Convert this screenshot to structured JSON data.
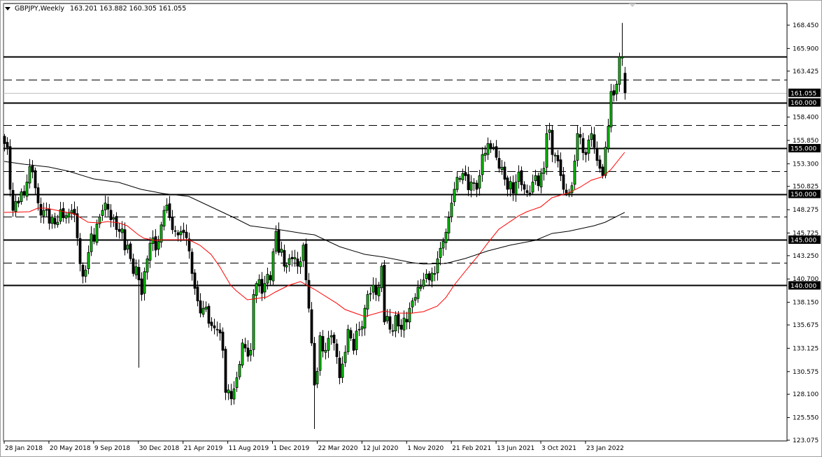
{
  "header": {
    "symbol": "GBPJPY,Weekly",
    "ohlc": "163.201 163.882 160.305 161.055"
  },
  "chart_data": {
    "type": "candlestick",
    "title": "GBPJPY,Weekly",
    "ylim": [
      123.075,
      168.45
    ],
    "y_ticks": [
      "168.450",
      "165.900",
      "163.425",
      "158.400",
      "155.850",
      "153.300",
      "150.825",
      "148.275",
      "145.725",
      "143.250",
      "140.700",
      "138.150",
      "135.675",
      "133.125",
      "130.575",
      "128.100",
      "125.550",
      "123.075"
    ],
    "y_tick_values": [
      168.45,
      165.9,
      163.425,
      158.4,
      155.85,
      153.3,
      150.825,
      148.275,
      145.725,
      143.25,
      140.7,
      138.15,
      135.675,
      133.125,
      130.575,
      128.1,
      125.55,
      123.075
    ],
    "x_ticks": [
      {
        "label": "28 Jan 2018",
        "week": 0
      },
      {
        "label": "20 May 2018",
        "week": 16
      },
      {
        "label": "9 Sep 2018",
        "week": 32
      },
      {
        "label": "30 Dec 2018",
        "week": 48
      },
      {
        "label": "21 Apr 2019",
        "week": 64
      },
      {
        "label": "11 Aug 2019",
        "week": 80
      },
      {
        "label": "1 Dec 2019",
        "week": 96
      },
      {
        "label": "22 Mar 2020",
        "week": 112
      },
      {
        "label": "12 Jul 2020",
        "week": 128
      },
      {
        "label": "1 Nov 2020",
        "week": 144
      },
      {
        "label": "21 Feb 2021",
        "week": 160
      },
      {
        "label": "13 Jun 2021",
        "week": 176
      },
      {
        "label": "3 Oct 2021",
        "week": 192
      },
      {
        "label": "23 Jan 2022",
        "week": 208
      }
    ],
    "current_price": {
      "value": 161.055,
      "label": "161.055"
    },
    "horizontal_levels": [
      {
        "value": 165.0,
        "style": "solid"
      },
      {
        "value": 162.5,
        "style": "dashed"
      },
      {
        "value": 160.0,
        "style": "solid",
        "label": "160.000"
      },
      {
        "value": 157.5,
        "style": "dashed"
      },
      {
        "value": 155.0,
        "style": "solid",
        "label": "155.000"
      },
      {
        "value": 152.5,
        "style": "dashed"
      },
      {
        "value": 150.0,
        "style": "solid",
        "label": "150.000"
      },
      {
        "value": 147.5,
        "style": "dashed"
      },
      {
        "value": 145.0,
        "style": "solid",
        "label": "145.000"
      },
      {
        "value": 142.5,
        "style": "dashed"
      },
      {
        "value": 140.0,
        "style": "solid",
        "label": "140.000"
      }
    ],
    "candle_count": 223,
    "close_path": [
      [
        0,
        155.5
      ],
      [
        1,
        155.1
      ],
      [
        2,
        150.5
      ],
      [
        3,
        148.2
      ],
      [
        5,
        149
      ],
      [
        8,
        151.3
      ],
      [
        10,
        152.4
      ],
      [
        12,
        149
      ],
      [
        14,
        148.2
      ],
      [
        18,
        146.7
      ],
      [
        21,
        147.4
      ],
      [
        24,
        148.2
      ],
      [
        26,
        145.2
      ],
      [
        28,
        141
      ],
      [
        30,
        143.6
      ],
      [
        33,
        146.7
      ],
      [
        35,
        148.2
      ],
      [
        36,
        149
      ],
      [
        39,
        147.4
      ],
      [
        41,
        145.9
      ],
      [
        44,
        144.4
      ],
      [
        46,
        141.3
      ],
      [
        48,
        140.6
      ],
      [
        49,
        139
      ],
      [
        51,
        142.9
      ],
      [
        53,
        145.2
      ],
      [
        55,
        144.8
      ],
      [
        57,
        148.2
      ],
      [
        59,
        147.4
      ],
      [
        61,
        145.9
      ],
      [
        63,
        145.9
      ],
      [
        65,
        145.2
      ],
      [
        67,
        141.3
      ],
      [
        69,
        138.3
      ],
      [
        71,
        137.5
      ],
      [
        74,
        135.6
      ],
      [
        76,
        135.2
      ],
      [
        78,
        132.9
      ],
      [
        79,
        128.3
      ],
      [
        81,
        127.6
      ],
      [
        83,
        129.9
      ],
      [
        85,
        133.7
      ],
      [
        88,
        132.9
      ],
      [
        89,
        139
      ],
      [
        90,
        140.2
      ],
      [
        93,
        140.2
      ],
      [
        95,
        140.6
      ],
      [
        97,
        145.9
      ],
      [
        98,
        143.6
      ],
      [
        100,
        142.1
      ],
      [
        103,
        142.9
      ],
      [
        105,
        142.1
      ],
      [
        107,
        144.4
      ],
      [
        108,
        140.6
      ],
      [
        109,
        137.5
      ],
      [
        110,
        133.7
      ],
      [
        111,
        129.1
      ],
      [
        112,
        130.6
      ],
      [
        113,
        134.5
      ],
      [
        115,
        132.9
      ],
      [
        117,
        134.5
      ],
      [
        119,
        132.2
      ],
      [
        120,
        129.9
      ],
      [
        121,
        131.4
      ],
      [
        123,
        135.2
      ],
      [
        125,
        132.9
      ],
      [
        127,
        135.2
      ],
      [
        129,
        137.5
      ],
      [
        130,
        139
      ],
      [
        133,
        139
      ],
      [
        134,
        139.8
      ],
      [
        135,
        142.1
      ],
      [
        136,
        136
      ],
      [
        138,
        135.2
      ],
      [
        140,
        136.7
      ],
      [
        142,
        135.2
      ],
      [
        144,
        136
      ],
      [
        145,
        137.5
      ],
      [
        146,
        138.3
      ],
      [
        148,
        139.8
      ],
      [
        150,
        140.6
      ],
      [
        152,
        140.6
      ],
      [
        154,
        141.3
      ],
      [
        155,
        142.9
      ],
      [
        157,
        144.8
      ],
      [
        159,
        147.4
      ],
      [
        160,
        149
      ],
      [
        161,
        150.5
      ],
      [
        163,
        151.6
      ],
      [
        165,
        152
      ],
      [
        167,
        151.3
      ],
      [
        169,
        150.5
      ],
      [
        170,
        152
      ],
      [
        171,
        154.3
      ],
      [
        173,
        155.5
      ],
      [
        175,
        155.1
      ],
      [
        177,
        152.8
      ],
      [
        179,
        151.6
      ],
      [
        180,
        150.5
      ],
      [
        183,
        151.3
      ],
      [
        184,
        152.4
      ],
      [
        186,
        150.5
      ],
      [
        188,
        150.1
      ],
      [
        189,
        151.3
      ],
      [
        190,
        152
      ],
      [
        191,
        150.9
      ],
      [
        193,
        152.8
      ],
      [
        194,
        156.6
      ],
      [
        195,
        157
      ],
      [
        196,
        154.3
      ],
      [
        198,
        153.6
      ],
      [
        199,
        152
      ],
      [
        200,
        150.5
      ],
      [
        201,
        150.1
      ],
      [
        203,
        150.9
      ],
      [
        204,
        153.6
      ],
      [
        205,
        156.6
      ],
      [
        206,
        156.2
      ],
      [
        208,
        154.3
      ],
      [
        209,
        155.9
      ],
      [
        210,
        156.6
      ],
      [
        211,
        155.1
      ],
      [
        213,
        152.8
      ],
      [
        214,
        152
      ],
      [
        215,
        155.1
      ],
      [
        216,
        157.4
      ],
      [
        217,
        161.2
      ],
      [
        218,
        160.8
      ],
      [
        219,
        162
      ],
      [
        220,
        165
      ],
      [
        221,
        165
      ],
      [
        222,
        161.055
      ]
    ],
    "candle_overrides": [
      {
        "week": 48,
        "low": 131.0
      },
      {
        "week": 111,
        "low": 124.3
      },
      {
        "week": 221,
        "high": 168.7
      },
      {
        "week": 222,
        "open": 163.201,
        "high": 163.882,
        "low": 160.305,
        "close": 161.055
      }
    ],
    "series": [
      {
        "name": "MA fast",
        "color": "#ff0000",
        "points": [
          [
            0,
            147.98
          ],
          [
            9,
            148.05
          ],
          [
            12,
            148.44
          ],
          [
            15,
            148.44
          ],
          [
            20,
            148.13
          ],
          [
            25,
            147.82
          ],
          [
            30,
            146.91
          ],
          [
            34,
            146.83
          ],
          [
            37,
            146.98
          ],
          [
            41,
            146.83
          ],
          [
            44,
            146.52
          ],
          [
            48,
            145.53
          ],
          [
            50,
            145.15
          ],
          [
            54,
            144.92
          ],
          [
            57,
            145.0
          ],
          [
            66,
            145.0
          ],
          [
            70,
            144.39
          ],
          [
            74,
            143.39
          ],
          [
            77,
            142.1
          ],
          [
            81,
            140.03
          ],
          [
            83,
            139.42
          ],
          [
            87,
            138.43
          ],
          [
            89,
            138.5
          ],
          [
            94,
            138.73
          ],
          [
            97,
            139.27
          ],
          [
            102,
            140.03
          ],
          [
            106,
            140.41
          ],
          [
            111,
            139.57
          ],
          [
            119,
            138.04
          ],
          [
            122,
            137.36
          ],
          [
            129,
            136.59
          ],
          [
            136,
            137.2
          ],
          [
            140,
            136.97
          ],
          [
            146,
            136.97
          ],
          [
            150,
            137.13
          ],
          [
            155,
            137.74
          ],
          [
            158,
            138.66
          ],
          [
            161,
            140.03
          ],
          [
            165,
            141.56
          ],
          [
            170,
            143.39
          ],
          [
            173,
            144.62
          ],
          [
            177,
            146.14
          ],
          [
            184,
            147.59
          ],
          [
            187,
            148.05
          ],
          [
            192,
            148.59
          ],
          [
            196,
            149.58
          ],
          [
            202,
            150.12
          ],
          [
            206,
            150.73
          ],
          [
            210,
            151.49
          ],
          [
            214,
            151.87
          ],
          [
            217,
            152.64
          ],
          [
            222,
            154.55
          ]
        ]
      },
      {
        "name": "MA slow",
        "color": "#000000",
        "points": [
          [
            0,
            153.55
          ],
          [
            7,
            153.25
          ],
          [
            16,
            152.94
          ],
          [
            23,
            152.48
          ],
          [
            32,
            151.64
          ],
          [
            41,
            151.26
          ],
          [
            49,
            150.5
          ],
          [
            57,
            150.04
          ],
          [
            66,
            149.73
          ],
          [
            74,
            148.59
          ],
          [
            82,
            147.44
          ],
          [
            88,
            146.52
          ],
          [
            99,
            146.07
          ],
          [
            107,
            145.68
          ],
          [
            111,
            145.53
          ],
          [
            120,
            144.23
          ],
          [
            129,
            143.39
          ],
          [
            136,
            143.09
          ],
          [
            146,
            142.48
          ],
          [
            150,
            142.33
          ],
          [
            158,
            142.4
          ],
          [
            165,
            142.94
          ],
          [
            173,
            143.77
          ],
          [
            181,
            144.39
          ],
          [
            190,
            144.92
          ],
          [
            196,
            145.68
          ],
          [
            202,
            145.92
          ],
          [
            211,
            146.52
          ],
          [
            215,
            146.9
          ],
          [
            222,
            147.98
          ]
        ]
      }
    ],
    "colors": {
      "bull": "#00c800",
      "bear": "#000000",
      "grid": "#000000",
      "current": "#c0c0c0"
    }
  }
}
